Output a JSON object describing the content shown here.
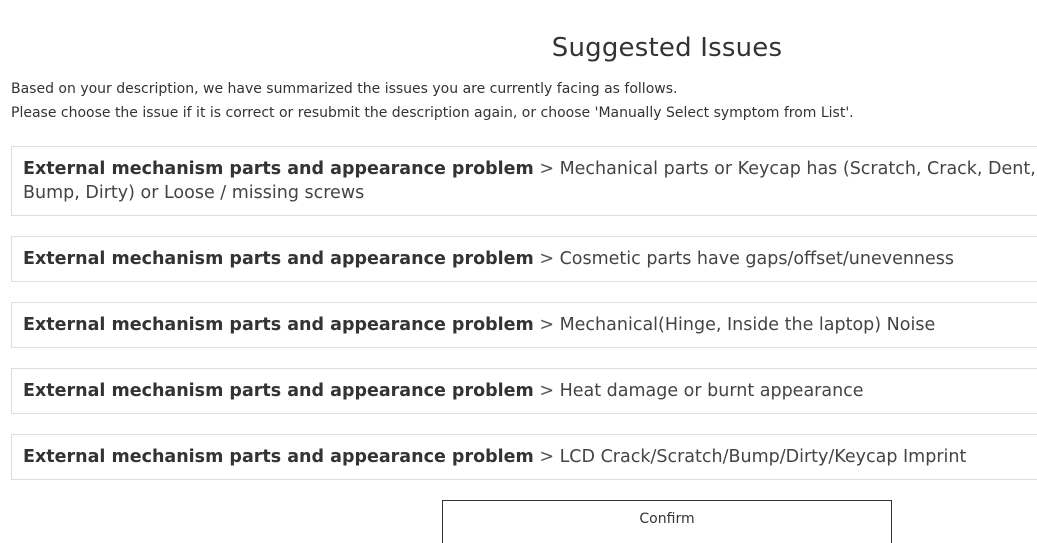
{
  "header": {
    "title": "Suggested Issues"
  },
  "description": {
    "line1": "Based on your description, we have summarized the issues you are currently facing as follows.",
    "line2": "Please choose the issue if it is correct or resubmit the description again, or choose 'Manually Select symptom from List'."
  },
  "issues": [
    {
      "category": "External mechanism parts and appearance problem",
      "separator": ">",
      "symptom": "Mechanical parts or Keycap has (Scratch, Crack, Dent, Bump, Dirty) or Loose / missing screws"
    },
    {
      "category": "External mechanism parts and appearance problem",
      "separator": ">",
      "symptom": "Cosmetic parts have gaps/offset/unevenness"
    },
    {
      "category": "External mechanism parts and appearance problem",
      "separator": ">",
      "symptom": "Mechanical(Hinge, Inside the laptop) Noise"
    },
    {
      "category": "External mechanism parts and appearance problem",
      "separator": ">",
      "symptom": "Heat damage or burnt appearance"
    },
    {
      "category": "External mechanism parts and appearance problem",
      "separator": ">",
      "symptom": "LCD Crack/Scratch/Bump/Dirty/Keycap Imprint"
    }
  ],
  "actions": {
    "confirm_label": "Confirm"
  }
}
